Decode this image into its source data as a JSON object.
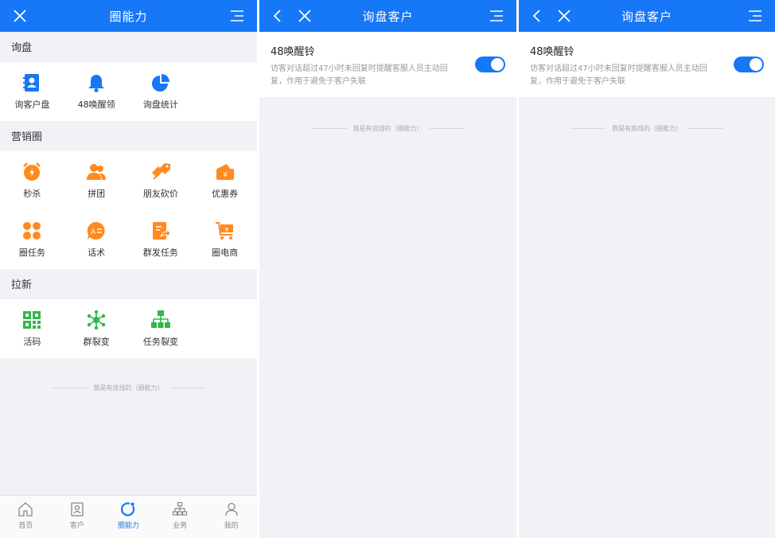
{
  "screen1": {
    "header_title": "圈能力",
    "sections": [
      {
        "title": "询盘",
        "items": [
          {
            "label": "询客户盘",
            "icon": "contacts-book-icon",
            "color": "#1677f7"
          },
          {
            "label": "48唤醒领",
            "icon": "bell-icon",
            "color": "#1677f7"
          },
          {
            "label": "询盘统计",
            "icon": "pie-chart-icon",
            "color": "#1677f7"
          }
        ]
      },
      {
        "title": "营销圈",
        "items": [
          {
            "label": "秒杀",
            "icon": "alarm-clock-icon",
            "color": "#ff8a1f"
          },
          {
            "label": "拼团",
            "icon": "group-users-icon",
            "color": "#ff8a1f"
          },
          {
            "label": "朋友砍价",
            "icon": "price-tag-icon",
            "color": "#ff8a1f"
          },
          {
            "label": "优惠券",
            "icon": "coupon-icon",
            "color": "#ff8a1f"
          },
          {
            "label": "圈任务",
            "icon": "clover-icon",
            "color": "#ff8a1f"
          },
          {
            "label": "话术",
            "icon": "chat-bubble-icon",
            "color": "#ff8a1f"
          },
          {
            "label": "群发任务",
            "icon": "document-share-icon",
            "color": "#ff8a1f"
          },
          {
            "label": "圈电商",
            "icon": "shopping-cart-icon",
            "color": "#ff8a1f"
          }
        ]
      },
      {
        "title": "拉新",
        "items": [
          {
            "label": "活码",
            "icon": "qr-code-icon",
            "color": "#2eb84b"
          },
          {
            "label": "群裂变",
            "icon": "network-icon",
            "color": "#2eb84b"
          },
          {
            "label": "任务裂变",
            "icon": "org-chart-icon",
            "color": "#2eb84b"
          }
        ]
      }
    ],
    "footer_text": "我是有底线的（圈能力）",
    "tabs": [
      {
        "label": "首页",
        "icon": "home-icon",
        "active": false
      },
      {
        "label": "客户",
        "icon": "contact-card-icon",
        "active": false
      },
      {
        "label": "圈能力",
        "icon": "refresh-circle-icon",
        "active": true
      },
      {
        "label": "业务",
        "icon": "hierarchy-icon",
        "active": false
      },
      {
        "label": "我的",
        "icon": "person-icon",
        "active": false
      }
    ]
  },
  "screen2": {
    "header_title": "询盘客户",
    "setting_name": "48唤醒铃",
    "setting_desc": "访客对话超过47小时未回复时提醒客服人员主动回复，作用于避免于客户失联",
    "setting_enabled": true,
    "footer_text": "我是有底线的（圈能力）"
  },
  "screen3": {
    "header_title": "询盘客户",
    "setting_name": "48唤醒铃",
    "setting_desc": "访客对话超过47小时未回复时提醒客服人员主动回复，作用于避免于客户失联",
    "setting_enabled": true,
    "footer_text": "我是有底线的（圈能力）"
  },
  "colors": {
    "primary": "#1677f7",
    "orange": "#ff8a1f",
    "green": "#2eb84b"
  }
}
